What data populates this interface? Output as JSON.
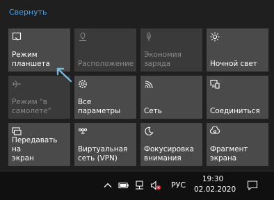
{
  "action_center": {
    "collapse_label": "Свернуть",
    "tiles": [
      {
        "label": "Режим\nпланшета",
        "icon": "tablet-mode-icon",
        "enabled": true
      },
      {
        "label": "Расположение",
        "icon": "location-icon",
        "enabled": false
      },
      {
        "label": "Экономия\nзаряда",
        "icon": "battery-saver-icon",
        "enabled": false
      },
      {
        "label": "Ночной свет",
        "icon": "night-light-icon",
        "enabled": true
      },
      {
        "label": "Режим \"в\nсамолете\"",
        "icon": "airplane-icon",
        "enabled": false
      },
      {
        "label": "Все\nпараметры",
        "icon": "settings-gear-icon",
        "enabled": true
      },
      {
        "label": "Сеть",
        "icon": "network-icon",
        "enabled": true
      },
      {
        "label": "Соединиться",
        "icon": "connect-icon",
        "enabled": true
      },
      {
        "label": "Передавать на\nэкран",
        "icon": "project-icon",
        "enabled": true
      },
      {
        "label": "Виртуальная\nсеть (VPN)",
        "icon": "vpn-icon",
        "enabled": true
      },
      {
        "label": "Фокусировка\nвнимания",
        "icon": "focus-assist-icon",
        "enabled": true
      },
      {
        "label": "Фрагмент\nэкрана",
        "icon": "screen-snip-icon",
        "enabled": true
      }
    ]
  },
  "taskbar": {
    "language": "РУС",
    "time": "19:30",
    "date": "02.02.2020"
  },
  "colors": {
    "accent": "#4aa3e8",
    "tile_bg": "#4a4a4a",
    "panel_bg": "#1f1f1f",
    "taskbar_bg": "#101010"
  }
}
